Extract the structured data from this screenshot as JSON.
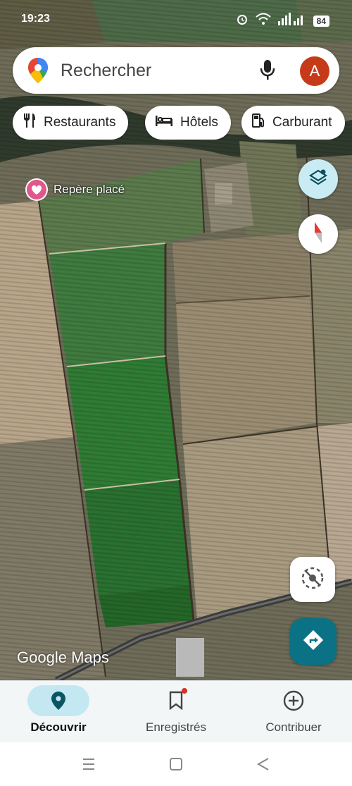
{
  "status": {
    "time": "19:23",
    "battery": "84"
  },
  "search": {
    "placeholder": "Rechercher",
    "avatar_letter": "A"
  },
  "chips": [
    {
      "label": "Restaurants",
      "icon": "fork-knife-icon"
    },
    {
      "label": "Hôtels",
      "icon": "bed-icon"
    },
    {
      "label": "Carburant",
      "icon": "fuel-pump-icon"
    }
  ],
  "marker": {
    "label": "Repère placé",
    "icon": "heart-icon"
  },
  "brand": {
    "google": "Google",
    "maps": "Maps"
  },
  "bottom_nav": [
    {
      "label": "Découvrir",
      "icon": "location-pin-icon",
      "active": true
    },
    {
      "label": "Enregistrés",
      "icon": "bookmark-icon",
      "badge": true
    },
    {
      "label": "Contribuer",
      "icon": "add-circle-icon"
    }
  ],
  "colors": {
    "accent": "#0b7285",
    "avatar": "#c53a18",
    "active_pill": "#c4e8f2"
  }
}
